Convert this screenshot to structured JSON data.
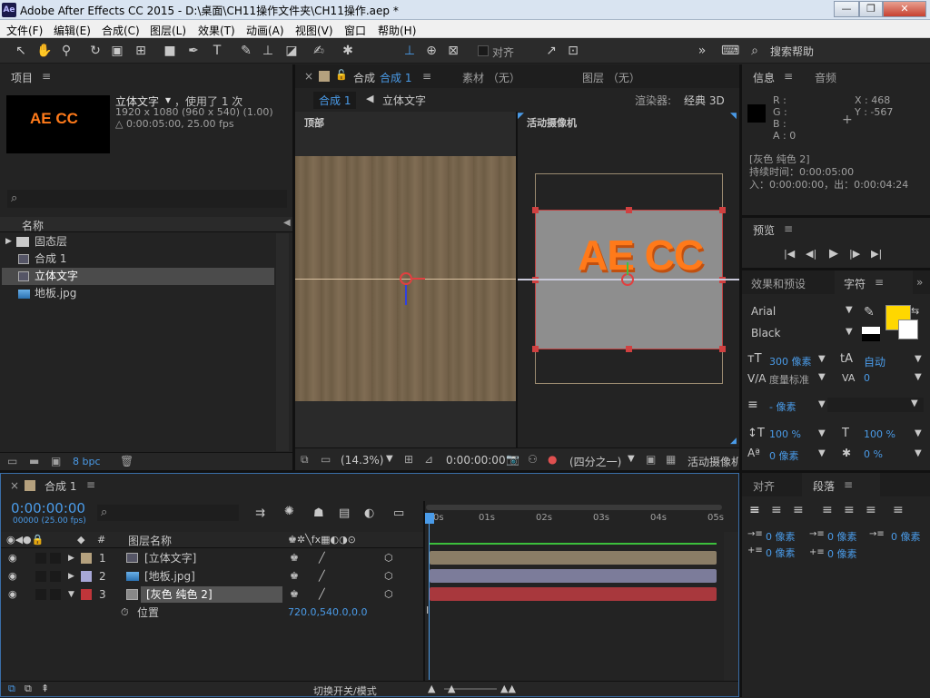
{
  "window": {
    "title": "Adobe After Effects CC 2015 - D:\\桌面\\CH11操作文件夹\\CH11操作.aep *",
    "logo": "Ae",
    "btn_min": "—",
    "btn_max": "❐",
    "btn_close": "✕"
  },
  "menu": [
    "文件(F)",
    "编辑(E)",
    "合成(C)",
    "图层(L)",
    "效果(T)",
    "动画(A)",
    "视图(V)",
    "窗口",
    "帮助(H)"
  ],
  "toolbar": {
    "snap_label": "对齐",
    "search_placeholder": "搜索帮助",
    "more": "»"
  },
  "project": {
    "tab": "项目",
    "thumb_text": "AE CC",
    "item_name": "立体文字",
    "used": "，使用了 1 次",
    "dims": "1920 x 1080  (960 x 540) (1.00)",
    "duration": "△ 0:00:05:00, 25.00 fps",
    "search_icon": "⌕",
    "col_name": "名称",
    "items": [
      {
        "name": "固态层",
        "type": "folder"
      },
      {
        "name": "合成 1",
        "type": "comp"
      },
      {
        "name": "立体文字",
        "type": "comp"
      },
      {
        "name": "地板.jpg",
        "type": "image"
      }
    ],
    "bpc": "8 bpc"
  },
  "comp_panel": {
    "tab_prefix": "合成",
    "tab_name": "合成 1",
    "tab_footage": "素材 （无）",
    "tab_layer": "图层 （无）",
    "crumb1": "合成 1",
    "crumb2": "立体文字",
    "renderer_label": "渲染器:",
    "renderer_value": "经典 3D",
    "view_left": "顶部",
    "view_right": "活动摄像机",
    "text_3d": "AE CC",
    "zoom": "(14.3%)",
    "timecode": "0:00:00:00",
    "resolution": "(四分之一)",
    "camera": "活动摄像机"
  },
  "info": {
    "tab_info": "信息",
    "tab_audio": "音频",
    "r": "R :",
    "g": "G :",
    "b": "B :",
    "a": "A : 0",
    "x": "X : 468",
    "y": "Y : -567",
    "layer": "[灰色 纯色 2]",
    "dur": "持续时间：0:00:05:00",
    "inout": "入：0:00:00:00，出：0:00:04:24"
  },
  "preview": {
    "tab": "预览",
    "first": "|◀",
    "prev": "◀|",
    "play": "▶",
    "next": "|▶",
    "last": "▶|"
  },
  "character": {
    "tab_effects": "效果和预设",
    "tab_char": "字符",
    "font": "Arial",
    "style": "Black",
    "size": "300 像素",
    "leading": "自动",
    "kerning": "度量标准",
    "tracking": "0",
    "stroke": "- 像素",
    "vscale": "100 %",
    "hscale": "100 %",
    "baseline": "0 像素",
    "tsume": "0 %",
    "fill_color": "#ffd700"
  },
  "paragraph": {
    "tab_align": "对齐",
    "tab_para": "段落",
    "indent_left": "0 像素",
    "indent_first": "0 像素",
    "indent_right": "0 像素",
    "space_before": "0 像素",
    "space_after": "0 像素"
  },
  "timeline": {
    "tab": "合成 1",
    "timecode": "0:00:00:00",
    "fps": "00000 (25.00 fps)",
    "col_hash": "#",
    "col_name": "图层名称",
    "ruler": [
      "0s",
      "01s",
      "02s",
      "03s",
      "04s",
      "05s"
    ],
    "layers": [
      {
        "num": "1",
        "name": "[立体文字]",
        "color": "#b5a17e",
        "bar": "#8a7d66"
      },
      {
        "num": "2",
        "name": "[地板.jpg]",
        "color": "#a7a7d7",
        "bar": "#7c7c9a"
      },
      {
        "num": "3",
        "name": "[灰色 纯色 2]",
        "color": "#c0353a",
        "bar": "#a8383d"
      }
    ],
    "prop_name": "位置",
    "prop_value": "720.0,540.0,0.0",
    "switch_mode": "切换开关/模式"
  }
}
